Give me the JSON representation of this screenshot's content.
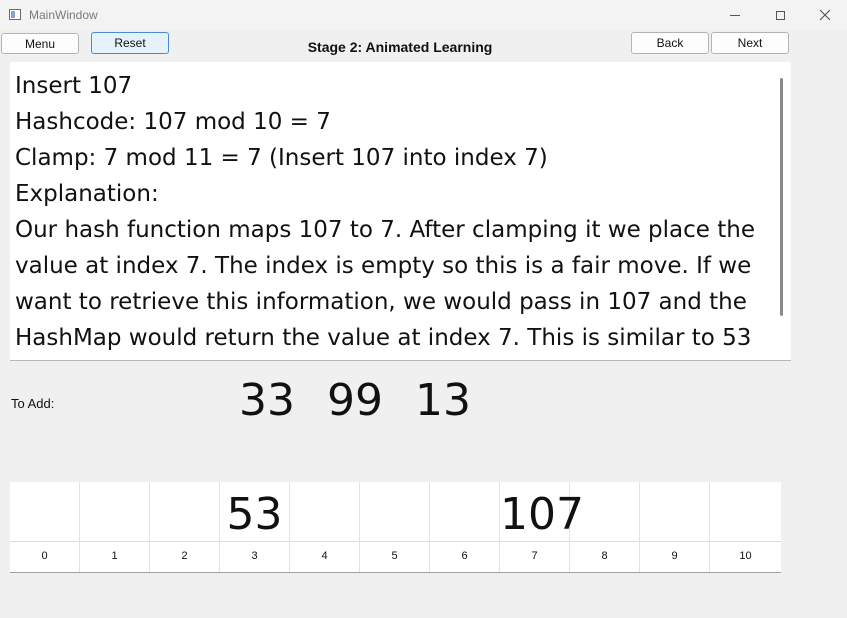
{
  "window": {
    "title": "MainWindow"
  },
  "toolbar": {
    "menu_label": "Menu",
    "reset_label": "Reset",
    "back_label": "Back",
    "next_label": "Next"
  },
  "stage_title": "Stage 2: Animated Learning",
  "explanation": {
    "lines": [
      "Insert 107",
      "Hashcode: 107 mod 10 = 7",
      "Clamp: 7 mod 11 = 7 (Insert 107 into index 7)",
      "Explanation:",
      "Our hash function maps 107 to 7. After clamping it we place the",
      "value at index 7. The index is empty so this is a fair move. If we",
      "want to retrieve this information, we would pass in 107 and the",
      "HashMap would return the value at index 7. This is similar to 53"
    ]
  },
  "to_add": {
    "label": "To Add:",
    "values": [
      "33",
      "99",
      "13"
    ]
  },
  "table": {
    "cells": [
      {
        "index": "0",
        "value": ""
      },
      {
        "index": "1",
        "value": ""
      },
      {
        "index": "2",
        "value": ""
      },
      {
        "index": "3",
        "value": "53"
      },
      {
        "index": "4",
        "value": ""
      },
      {
        "index": "5",
        "value": ""
      },
      {
        "index": "6",
        "value": ""
      },
      {
        "index": "7",
        "value": "107"
      },
      {
        "index": "8",
        "value": ""
      },
      {
        "index": "9",
        "value": ""
      },
      {
        "index": "10",
        "value": ""
      }
    ]
  }
}
